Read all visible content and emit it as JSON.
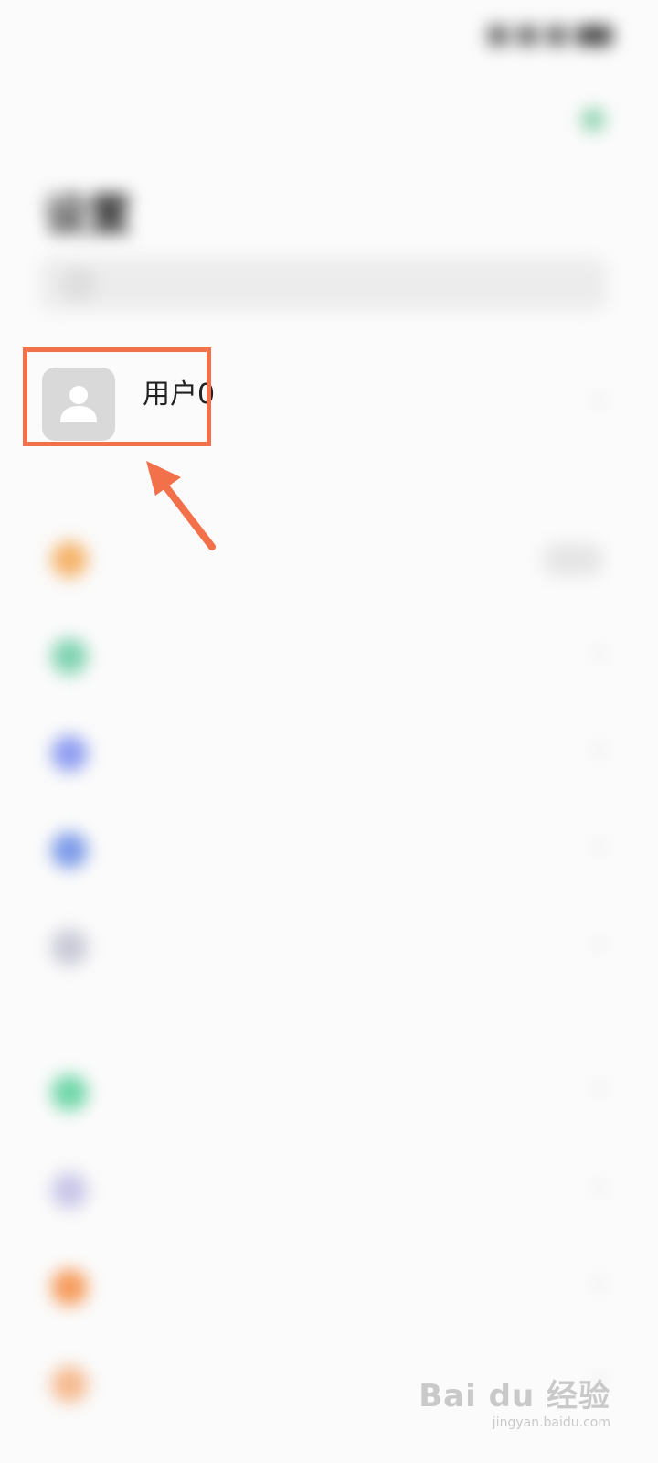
{
  "status_bar": {
    "time": "",
    "icons": [
      "signal-icon",
      "wifi-icon",
      "battery-icon"
    ]
  },
  "header": {
    "title": "设置"
  },
  "search": {
    "placeholder": ""
  },
  "profile": {
    "name": "用户0",
    "subtitle": "",
    "avatar_icon": "person-icon"
  },
  "settings_items": [
    {
      "label": "",
      "value": "",
      "icon_color": "#f5b36a",
      "control": "toggle"
    },
    {
      "label": "",
      "value": "",
      "icon_color": "#7fd3b1",
      "control": "chevron"
    },
    {
      "label": "",
      "value": "",
      "icon_color": "#8e9df0",
      "control": "chevron"
    },
    {
      "label": "",
      "value": "",
      "icon_color": "#7b9ae8",
      "control": "chevron"
    },
    {
      "label": "",
      "value": "",
      "icon_color": "#c8c9d6",
      "control": "chevron"
    },
    {
      "label": "",
      "value": "",
      "icon_color": "#6fd6a8",
      "control": "chevron"
    },
    {
      "label": "",
      "value": "",
      "icon_color": "#c9c6e8",
      "control": "chevron"
    },
    {
      "label": "",
      "value": "",
      "icon_color": "#f59a5a",
      "control": "chevron"
    },
    {
      "label": "",
      "value": "",
      "icon_color": "#f5b98e",
      "control": "chevron"
    }
  ],
  "annotation": {
    "highlight_color": "#f2704a"
  },
  "watermark": {
    "main": "Bai du 经验",
    "sub": "jingyan.baidu.com"
  }
}
